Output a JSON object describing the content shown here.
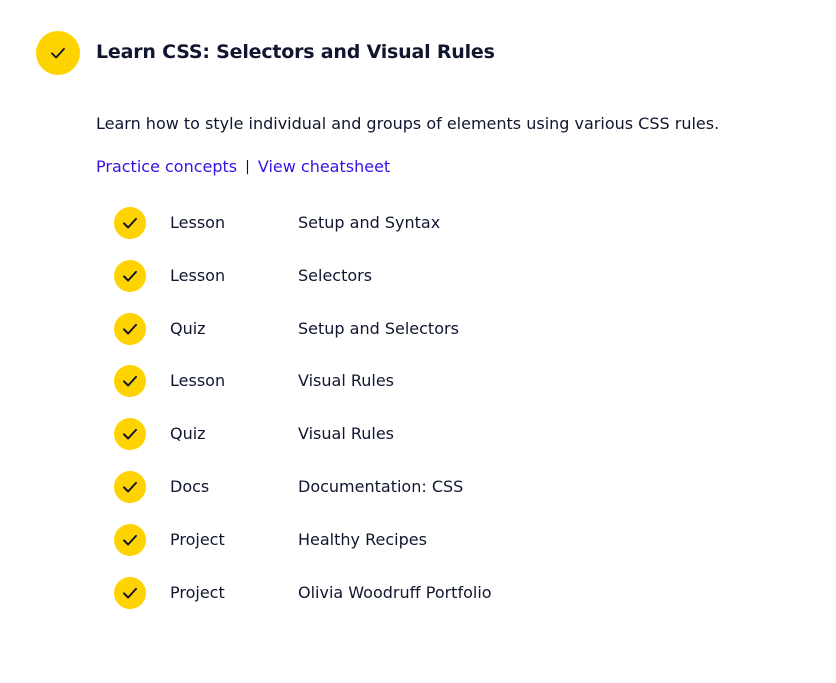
{
  "module": {
    "title": "Learn CSS: Selectors and Visual Rules",
    "description": "Learn how to style individual and groups of elements using various CSS rules.",
    "links": {
      "practice": "Practice concepts",
      "separator": "|",
      "cheatsheet": "View cheatsheet"
    },
    "completed": true,
    "items": [
      {
        "type": "Lesson",
        "title": "Setup and Syntax",
        "completed": true
      },
      {
        "type": "Lesson",
        "title": "Selectors",
        "completed": true
      },
      {
        "type": "Quiz",
        "title": "Setup and Selectors",
        "completed": true
      },
      {
        "type": "Lesson",
        "title": "Visual Rules",
        "completed": true
      },
      {
        "type": "Quiz",
        "title": "Visual Rules",
        "completed": true
      },
      {
        "type": "Docs",
        "title": "Documentation: CSS",
        "completed": true
      },
      {
        "type": "Project",
        "title": "Healthy Recipes",
        "completed": true
      },
      {
        "type": "Project",
        "title": "Olivia Woodruff Portfolio",
        "completed": true
      }
    ]
  },
  "colors": {
    "check_fill": "#ffd300",
    "text": "#10162f",
    "link": "#3a10e5"
  },
  "icons": {
    "completed": "checkmark-icon"
  }
}
